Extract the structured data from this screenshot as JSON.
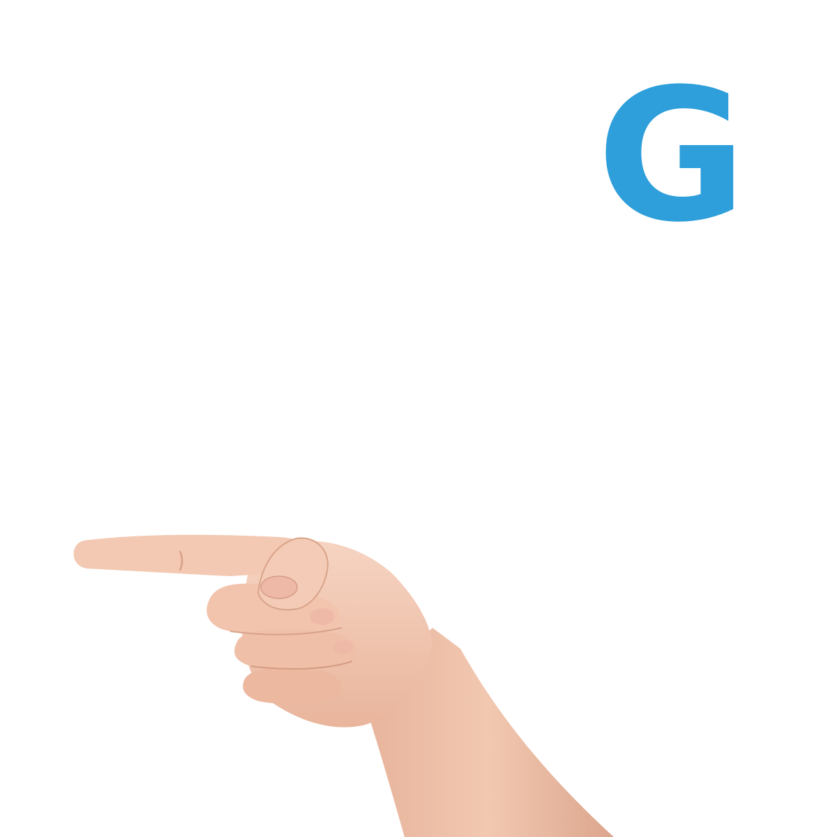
{
  "sign": {
    "letter": "G",
    "letter_color": "#2e9fdb",
    "illustration": "hand-g-handshape-icon"
  },
  "colors": {
    "background": "#ffffff",
    "skin": "#f3c9b3",
    "skin_shadow": "#dba58c",
    "skin_dark": "#c98f77",
    "nail": "#efb9a8"
  }
}
